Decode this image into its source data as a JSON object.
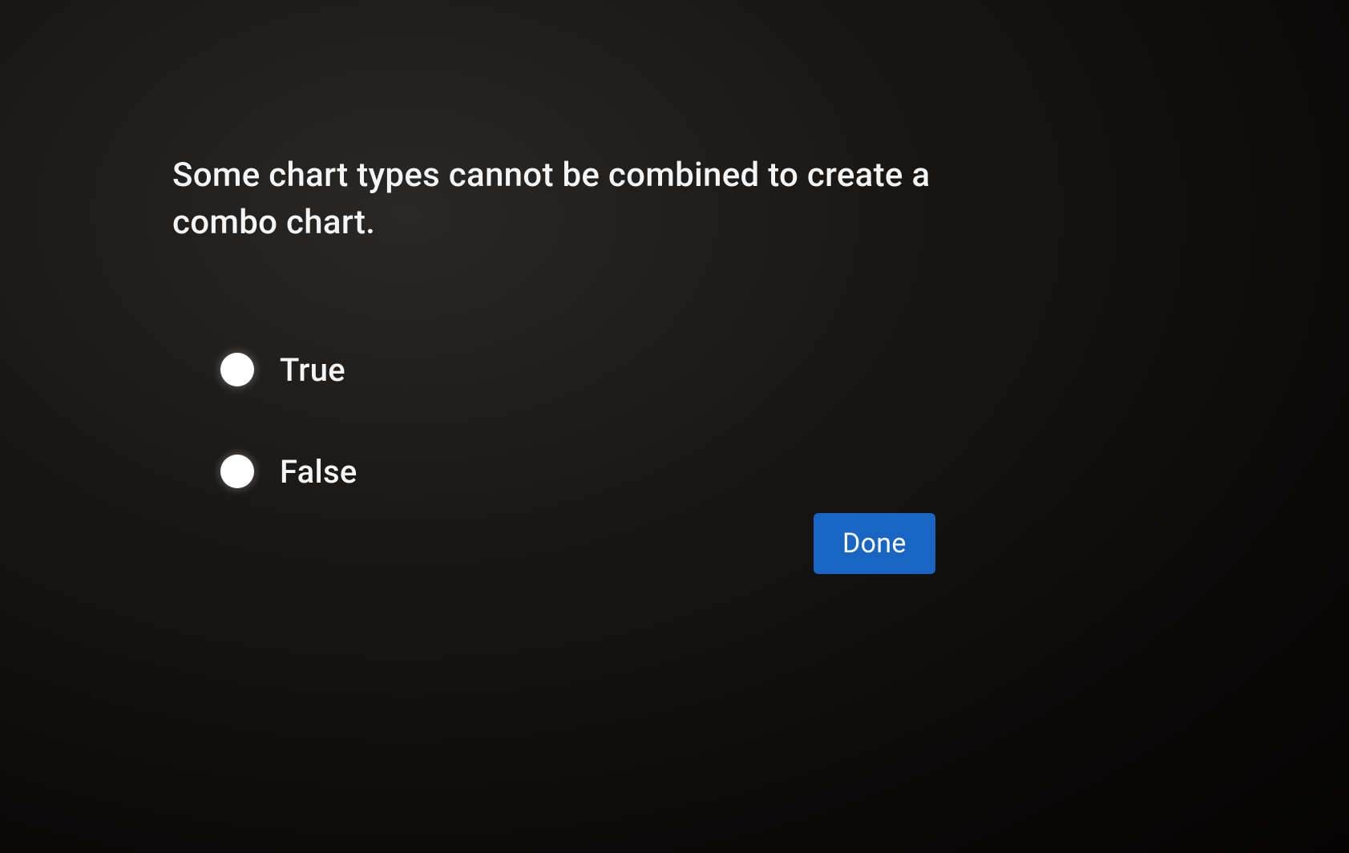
{
  "quiz": {
    "question": "Some chart types cannot be combined to create a combo chart.",
    "options": [
      {
        "label": "True"
      },
      {
        "label": "False"
      }
    ],
    "done_label": "Done"
  }
}
